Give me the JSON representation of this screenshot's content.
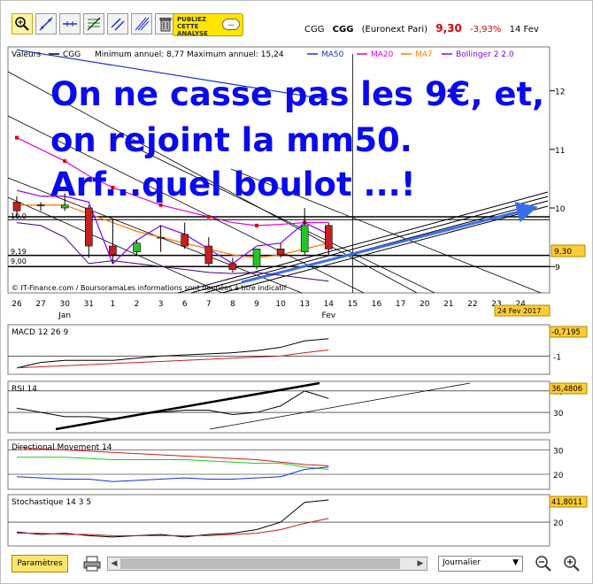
{
  "toolbar": {
    "tools": [
      "zoom-tool-icon",
      "trendline-icon",
      "horizontal-line-icon",
      "fibonacci-icon",
      "channel-icon",
      "parallel-lines-icon",
      "trash-icon"
    ],
    "ad_line1": "PUBLIEZ",
    "ad_line2": "CETTE",
    "ad_line3": "ANALYSE"
  },
  "quote": {
    "ticker": "CGG",
    "name": "CGG",
    "market": "(Euronext Pari)",
    "price": "9,30",
    "change": "-3,93%",
    "date": "14 Fev"
  },
  "main_panel": {
    "legend_title": "Valeurs",
    "legend_ticker": "CGG",
    "range_text": "Minimum annuel: 8,77 Maximum annuel: 15,24",
    "indicators": [
      {
        "label": "MA50",
        "color": "#1a2fd6"
      },
      {
        "label": "MA20",
        "color": "#e000e0"
      },
      {
        "label": "MA7",
        "color": "#ff7700"
      },
      {
        "label": "Bollinger 2 2.0",
        "color": "#8000ff"
      }
    ],
    "annotation_lines": [
      "On ne casse pas les 9€, et,",
      "on rejoint la mm50.",
      "Arf...quel boulot ...!"
    ],
    "annotation_color": "#0a0af0",
    "copyright": "© IT-Finance.com / BoursoramaLes informations sont données à titre indicatif",
    "left_levels": [
      "10,0",
      "9,19",
      "9,00"
    ],
    "price_tag": "9,30",
    "date_tag": "24 Fev 2017"
  },
  "chart_data": [
    {
      "type": "candlestick",
      "title": "CGG",
      "x_labels": [
        "26",
        "27",
        "30",
        "31",
        "1",
        "2",
        "3",
        "6",
        "7",
        "8",
        "9",
        "10",
        "13",
        "14",
        "15",
        "16",
        "17",
        "20",
        "21",
        "22",
        "23",
        "24"
      ],
      "month_labels": [
        "Jan",
        "Fev"
      ],
      "ylim": [
        8.55,
        12.75
      ],
      "yticks": [
        9,
        10,
        11,
        12
      ],
      "candles": [
        {
          "x": "26",
          "o": 10.1,
          "h": 10.2,
          "l": 9.85,
          "c": 9.95
        },
        {
          "x": "27",
          "o": 10.05,
          "h": 10.1,
          "l": 9.95,
          "c": 10.05
        },
        {
          "x": "30",
          "o": 10.0,
          "h": 10.25,
          "l": 9.95,
          "c": 10.05
        },
        {
          "x": "31",
          "o": 10.0,
          "h": 10.05,
          "l": 9.15,
          "c": 9.35
        },
        {
          "x": "1",
          "o": 9.35,
          "h": 9.8,
          "l": 9.05,
          "c": 9.2
        },
        {
          "x": "2",
          "o": 9.25,
          "h": 9.45,
          "l": 9.2,
          "c": 9.4
        },
        {
          "x": "3",
          "o": 9.5,
          "h": 9.7,
          "l": 9.25,
          "c": 9.5
        },
        {
          "x": "6",
          "o": 9.55,
          "h": 9.75,
          "l": 9.3,
          "c": 9.35
        },
        {
          "x": "7",
          "o": 9.35,
          "h": 9.5,
          "l": 9.0,
          "c": 9.05
        },
        {
          "x": "8",
          "o": 9.05,
          "h": 9.15,
          "l": 8.9,
          "c": 8.95
        },
        {
          "x": "9",
          "o": 9.0,
          "h": 9.3,
          "l": 8.95,
          "c": 9.3
        },
        {
          "x": "10",
          "o": 9.3,
          "h": 9.4,
          "l": 9.15,
          "c": 9.2
        },
        {
          "x": "13",
          "o": 9.25,
          "h": 10.0,
          "l": 9.2,
          "c": 9.7
        },
        {
          "x": "14",
          "o": 9.7,
          "h": 9.75,
          "l": 9.2,
          "c": 9.3
        }
      ],
      "series": [
        {
          "name": "MA50",
          "values": [
            12.7,
            null,
            null,
            null,
            null,
            null,
            null,
            null,
            null,
            null,
            null,
            null,
            null,
            11.85
          ]
        },
        {
          "name": "MA20",
          "values": [
            11.2,
            11.0,
            10.8,
            10.55,
            10.35,
            10.2,
            10.05,
            9.95,
            9.85,
            9.75,
            9.7,
            9.72,
            9.75,
            9.75
          ]
        },
        {
          "name": "MA7",
          "values": [
            10.05,
            10.05,
            10.05,
            9.9,
            9.75,
            9.6,
            9.5,
            9.4,
            9.3,
            9.2,
            9.15,
            9.2,
            9.3,
            9.4
          ]
        },
        {
          "name": "Bollinger 2 2.0",
          "values": [
            10.3,
            10.2,
            10.2,
            10.1,
            9.05,
            9.45,
            9.7,
            9.55,
            9.3,
            9.05,
            9.35,
            9.4,
            9.75,
            9.55
          ]
        }
      ],
      "horizontal_levels": [
        9.85,
        9.19,
        9.0
      ],
      "last_price": 9.3,
      "date_marker": "24 Fev 2017"
    },
    {
      "type": "line",
      "title": "MACD 12 26 9",
      "ylim": [
        -1.6,
        0.2
      ],
      "yticks": [
        -1
      ],
      "last_value_label": "-0,7195",
      "series": [
        {
          "name": "",
          "values": [
            -1.55,
            -1.3,
            -1.2,
            -1.2,
            -1.2,
            -1.1,
            -1.0,
            -0.95,
            -0.9,
            -0.85,
            -0.75,
            -0.6,
            -0.3,
            -0.2
          ]
        },
        {
          "name": "",
          "values": [
            -1.55,
            -1.5,
            -1.45,
            -1.4,
            -1.35,
            -1.3,
            -1.25,
            -1.2,
            -1.15,
            -1.1,
            -1.05,
            -1.0,
            -0.85,
            -0.72
          ]
        }
      ]
    },
    {
      "type": "line",
      "title": "RSI 14",
      "ylim": [
        23,
        42
      ],
      "yticks": [
        30,
        40
      ],
      "last_value_label": "36,4806",
      "series": [
        {
          "name": "",
          "values": [
            32,
            30,
            28,
            28,
            27,
            29,
            30,
            31,
            31,
            29,
            30,
            33,
            40,
            36.5
          ]
        }
      ]
    },
    {
      "type": "line",
      "title": "Directional Movement 14",
      "ylim": [
        16,
        32
      ],
      "yticks": [
        20,
        30
      ],
      "series": [
        {
          "name": "",
          "values": [
            31,
            30.5,
            30,
            29.5,
            29,
            28.5,
            28,
            27.5,
            27,
            26.5,
            26,
            25,
            24,
            23.5
          ]
        },
        {
          "name": "",
          "values": [
            27,
            27,
            27,
            26.5,
            26,
            26,
            26,
            26,
            25.5,
            25,
            24.5,
            24.5,
            23,
            22
          ]
        },
        {
          "name": "",
          "values": [
            19,
            18.5,
            18,
            18,
            17,
            17.5,
            18,
            18.5,
            18,
            18,
            18.5,
            19,
            22,
            23
          ]
        }
      ]
    },
    {
      "type": "line",
      "title": "Stochastique 14 3 5",
      "ylim": [
        5,
        38
      ],
      "yticks": [
        20
      ],
      "last_value_label": "41,8011",
      "series": [
        {
          "name": "",
          "values": [
            12,
            10,
            11,
            9,
            8,
            9,
            10,
            8,
            10,
            11,
            14,
            20,
            36,
            38
          ]
        },
        {
          "name": "",
          "values": [
            11,
            11,
            10,
            10,
            9,
            9,
            9,
            9,
            9,
            10,
            11,
            14,
            19,
            23
          ]
        }
      ]
    }
  ],
  "bottombar": {
    "params_label": "Paramètres",
    "period_value": "Journalier",
    "scroll_left": "◀",
    "scroll_right": "▶"
  }
}
